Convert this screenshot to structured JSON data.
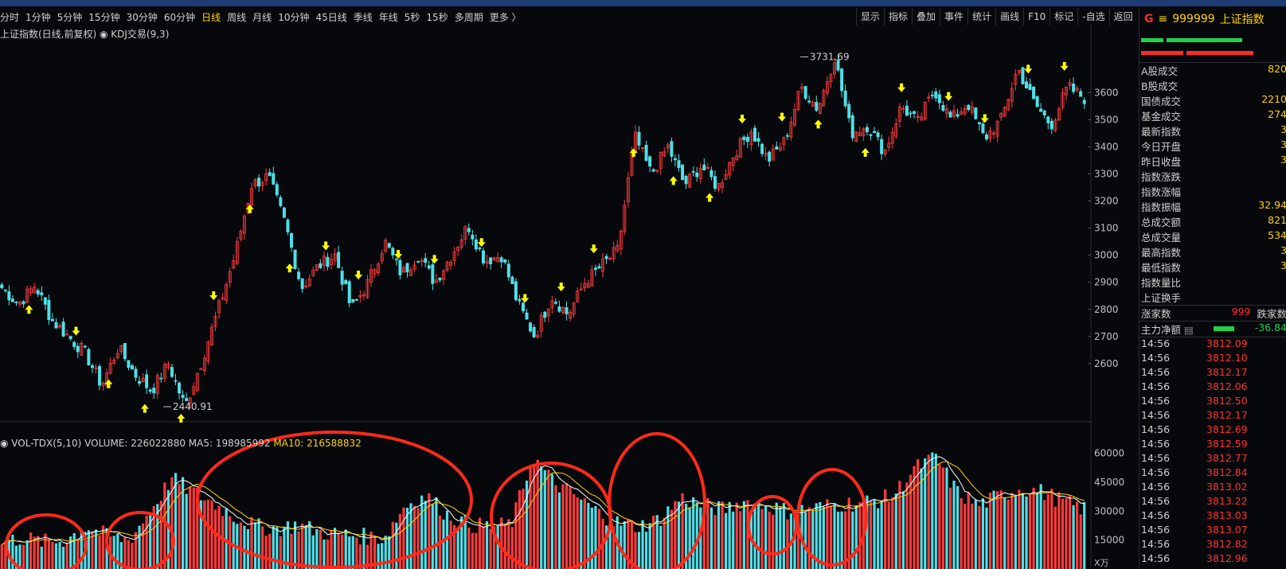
{
  "period_tabs": [
    "分时",
    "1分钟",
    "5分钟",
    "15分钟",
    "30分钟",
    "60分钟",
    "日线",
    "周线",
    "月线",
    "10分钟",
    "45日线",
    "季线",
    "年线",
    "5秒",
    "15秒",
    "多周期",
    "更多 〉"
  ],
  "active_tab": "日线",
  "right_buttons": [
    "显示",
    "指标",
    "叠加",
    "事件",
    "统计",
    "画线",
    "F10",
    "标记",
    "-自选",
    "返回"
  ],
  "chart_title": "上证指数(日线,前复权) ◉ KDJ交易(9,3)",
  "colors": {
    "up": "#ff3b3b",
    "down": "#4fe0e8",
    "ma5": "#ffffff",
    "ma10": "#ffd200",
    "annot": "#ff2a1a",
    "signal": "#ffff00"
  },
  "chart_data": [
    {
      "type": "candlestick",
      "title": "上证指数(日线,前复权)",
      "y_ticks": [
        2600,
        2700,
        2800,
        2900,
        3000,
        3100,
        3200,
        3300,
        3400,
        3500,
        3600
      ],
      "ylim": [
        2400,
        3780
      ],
      "annotations": [
        {
          "label": "3731.69",
          "value": 3731.69
        },
        {
          "label": "2440.91",
          "value": 2440.91
        }
      ],
      "close_path": [
        2880,
        2820,
        2890,
        2760,
        2700,
        2640,
        2520,
        2660,
        2560,
        2500,
        2600,
        2440.91,
        2610,
        2800,
        3000,
        3260,
        3290,
        3120,
        2880,
        2960,
        3000,
        2800,
        2900,
        3050,
        2930,
        3000,
        2900,
        3000,
        3110,
        2980,
        3000,
        2820,
        2700,
        2850,
        2780,
        2900,
        2960,
        3020,
        3440,
        3300,
        3400,
        3260,
        3330,
        3250,
        3380,
        3460,
        3350,
        3420,
        3620,
        3540,
        3731.69,
        3450,
        3480,
        3380,
        3550,
        3490,
        3610,
        3500,
        3560,
        3430,
        3500,
        3690,
        3560,
        3480,
        3620,
        3580
      ]
    },
    {
      "type": "bar",
      "title": "VOL-TDX(5,10)",
      "series": [
        {
          "name": "VOLUME",
          "value": 226022880
        },
        {
          "name": "MA5",
          "value": 198985992
        },
        {
          "name": "MA10",
          "value": 216588832
        }
      ],
      "y_ticks": [
        15000,
        30000,
        45000,
        60000
      ],
      "unit": "X万",
      "volume_path": [
        14000,
        16000,
        14000,
        15000,
        22000,
        17000,
        15000,
        30000,
        47000,
        40000,
        34000,
        27000,
        22000,
        21000,
        23000,
        19000,
        18000,
        17000,
        16000,
        33000,
        38000,
        28000,
        23000,
        22000,
        23000,
        58000,
        45000,
        38000,
        30000,
        24000,
        22000,
        26000,
        37000,
        33000,
        31000,
        35000,
        33000,
        30000,
        31000,
        33000,
        34000,
        35000,
        38000,
        52000,
        58000,
        40000,
        33000,
        38000,
        42000,
        40000,
        35000,
        31000
      ]
    }
  ],
  "vol_title": {
    "label": "◉ VOL-TDX(5,10)",
    "volume": "VOLUME: 226022880",
    "ma5": "MA5: 198985992",
    "ma10": "MA10: 216588832"
  },
  "vol_unit": "X万",
  "panel": {
    "code": "999999",
    "name": "上证指数",
    "stats": [
      {
        "k": "A股成交",
        "v": "820"
      },
      {
        "k": "B股成交",
        "v": ""
      },
      {
        "k": "国债成交",
        "v": "2210"
      },
      {
        "k": "基金成交",
        "v": "274"
      },
      {
        "k": "最新指数",
        "v": "3"
      },
      {
        "k": "今日开盘",
        "v": "3"
      },
      {
        "k": "昨日收盘",
        "v": "3"
      },
      {
        "k": "指数涨跌",
        "v": ""
      },
      {
        "k": "指数涨幅",
        "v": ""
      },
      {
        "k": "指数振幅",
        "v": "32.94"
      },
      {
        "k": "总成交额",
        "v": "821"
      },
      {
        "k": "总成交量",
        "v": "534"
      },
      {
        "k": "最高指数",
        "v": "3"
      },
      {
        "k": "最低指数",
        "v": "3"
      },
      {
        "k": "指数量比",
        "v": ""
      },
      {
        "k": "上证换手",
        "v": ""
      }
    ],
    "updown": {
      "label1": "涨家数",
      "v1": "999",
      "label2": "跌家数"
    },
    "mainflow": {
      "label": "主力净额",
      "v": "-36.84"
    },
    "ticks": [
      {
        "t": "14:56",
        "p": "3812.09"
      },
      {
        "t": "14:56",
        "p": "3812.10"
      },
      {
        "t": "14:56",
        "p": "3812.17"
      },
      {
        "t": "14:56",
        "p": "3812.06"
      },
      {
        "t": "14:56",
        "p": "3812.50"
      },
      {
        "t": "14:56",
        "p": "3812.17"
      },
      {
        "t": "14:56",
        "p": "3812.69"
      },
      {
        "t": "14:56",
        "p": "3812.59"
      },
      {
        "t": "14:56",
        "p": "3812.77"
      },
      {
        "t": "14:56",
        "p": "3812.84"
      },
      {
        "t": "14:56",
        "p": "3813.02"
      },
      {
        "t": "14:56",
        "p": "3813.22"
      },
      {
        "t": "14:56",
        "p": "3813.03"
      },
      {
        "t": "14:56",
        "p": "3813.07"
      },
      {
        "t": "14:56",
        "p": "3812.82"
      },
      {
        "t": "14:56",
        "p": "3812.96"
      }
    ]
  }
}
